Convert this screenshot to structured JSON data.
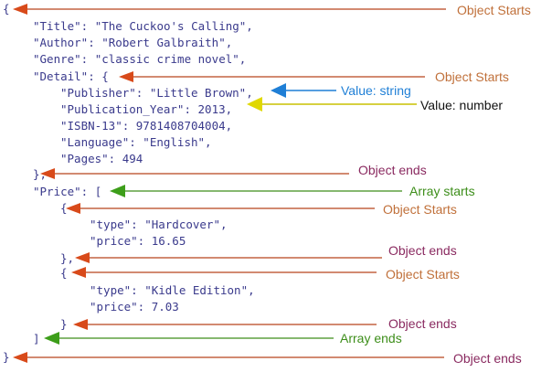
{
  "code_lines": [
    "{",
    "\"Title\": \"The Cuckoo's Calling\",",
    "\"Author\": \"Robert Galbraith\",",
    "\"Genre\": \"classic crime novel\",",
    "\"Detail\": {",
    "\"Publisher\": \"Little Brown\",",
    "\"Publication_Year\": 2013,",
    "\"ISBN-13\": 9781408704004,",
    "\"Language\": \"English\",",
    "\"Pages\": 494",
    "},",
    "\"Price\": [",
    "{",
    "\"type\": \"Hardcover\",",
    "\"price\": 16.65",
    "},",
    "{",
    "\"type\": \"Kidle Edition\",",
    "\"price\": 7.03",
    "}",
    "]",
    "}"
  ],
  "annotations": {
    "object_starts_1": "Object Starts",
    "object_starts_2": "Object Starts",
    "value_string": "Value: string",
    "value_number": "Value: number",
    "object_ends_1": "Object ends",
    "array_starts": "Array starts",
    "object_starts_3": "Object Starts",
    "object_ends_2": "Object ends",
    "object_starts_4": "Object Starts",
    "object_ends_3": "Object ends",
    "array_ends": "Array ends",
    "object_ends_4": "Object ends"
  },
  "colors": {
    "code_text": "#3a3a8c",
    "object_arrow": "#b8441c",
    "object_label": "#c0703a",
    "array_color": "#3d8e1a",
    "string_color": "#1f7fd6",
    "number_color": "#c8c000",
    "ends_label": "#8a2a60"
  }
}
